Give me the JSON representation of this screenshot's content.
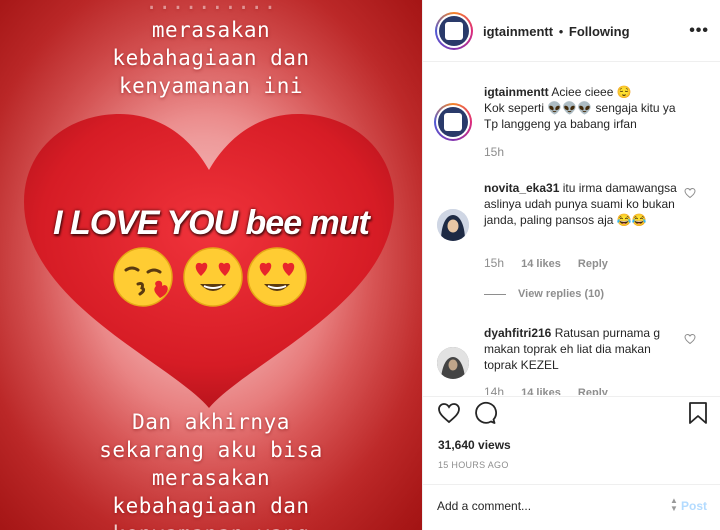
{
  "media": {
    "caption_top_lines": [
      "merasakan",
      "kebahagiaan dan",
      "kenyamanan ini"
    ],
    "caption_bottom_lines": [
      "Dan akhirnya",
      "sekarang aku bisa",
      "merasakan",
      "kebahagiaan dan",
      "kenyamanan yang"
    ],
    "overlay_text": "I LOVE YOU bee mut",
    "emojis": [
      "kissing-face-emoji",
      "heart-eyes-emoji",
      "heart-eyes-emoji"
    ]
  },
  "header": {
    "username": "igtainmentt",
    "separator": "•",
    "follow_status": "Following",
    "more_icon": "•••"
  },
  "caption": {
    "username": "igtainmentt",
    "lines": [
      "Aciee cieee 😌",
      "Kok seperti 👽👽👽 sengaja kitu ya",
      "Tp langgeng ya babang irfan"
    ],
    "time": "15h"
  },
  "comments": [
    {
      "username": "novita_eka31",
      "text": "itu irma damawangsa aslinya udah punya suami ko bukan janda, paling pansos aja 😂😂",
      "time": "15h",
      "likes": "14 likes",
      "reply": "Reply",
      "view_replies": "View replies (10)"
    },
    {
      "username": "dyahfitri216",
      "text": "Ratusan purnama g makan toprak eh liat dia makan toprak KEZEL",
      "time": "14h",
      "likes": "14 likes",
      "reply": "Reply"
    }
  ],
  "stats": {
    "views": "31,640 views",
    "time_ago": "15 HOURS AGO"
  },
  "add_comment": {
    "placeholder": "Add a comment...",
    "post_label": "Post"
  },
  "colors": {
    "accent_blue_disabled": "#b3dbff",
    "text_primary": "#262626",
    "text_secondary": "#8e8e8e",
    "heart_red": "#e8242c"
  }
}
